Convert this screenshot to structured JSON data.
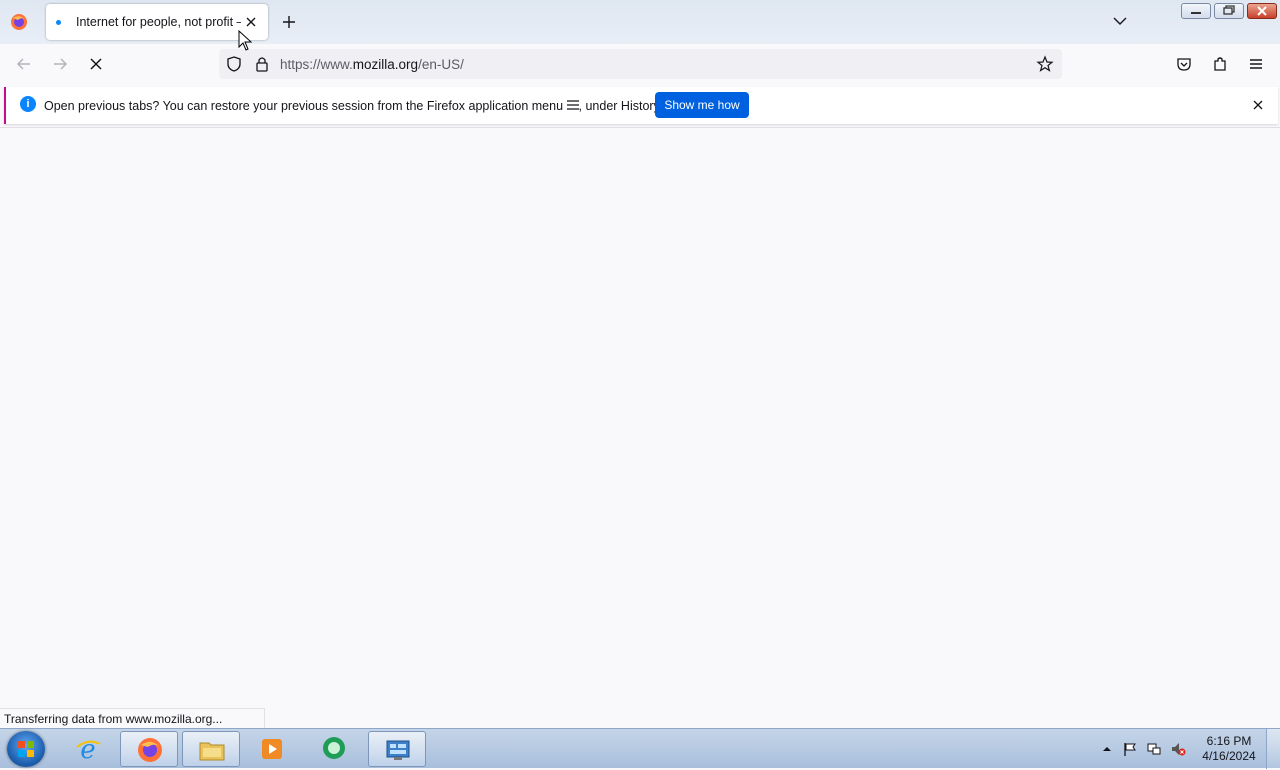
{
  "browser": {
    "tab": {
      "title": "Internet for people, not profit — Mozilla (US)",
      "loading": true
    },
    "url": {
      "prefix": "https://www.",
      "domain": "mozilla.org",
      "path": "/en-US/"
    },
    "window_buttons": [
      "minimize",
      "restore",
      "close"
    ]
  },
  "infobar": {
    "text_before": "Open previous tabs? You can restore your previous session from the Firefox application menu",
    "text_after": ", under History.",
    "button_label": "Show me how"
  },
  "status_text": "Transferring data from www.mozilla.org...",
  "taskbar": {
    "apps": [
      {
        "name": "internet-explorer",
        "active": false
      },
      {
        "name": "firefox",
        "active": true
      },
      {
        "name": "file-explorer",
        "active": true
      },
      {
        "name": "media-player",
        "active": false
      },
      {
        "name": "messenger",
        "active": false
      },
      {
        "name": "control-panel",
        "active": true
      }
    ],
    "clock": {
      "time": "6:16 PM",
      "date": "4/16/2024"
    }
  },
  "colors": {
    "accent": "#0061e0",
    "info_icon": "#0a84ff",
    "infobar_edge": "#c10e8d"
  }
}
